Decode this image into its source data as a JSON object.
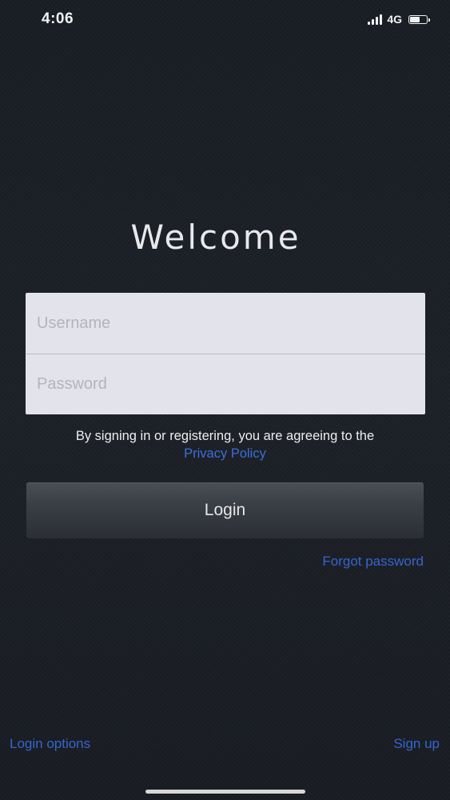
{
  "status_bar": {
    "time": "4:06",
    "network": "4G",
    "icons": [
      "signal-icon",
      "battery-icon"
    ]
  },
  "welcome": {
    "title": "Welcome"
  },
  "form": {
    "username_placeholder": "Username",
    "username_value": "",
    "password_placeholder": "Password",
    "password_value": ""
  },
  "terms": {
    "text": "By signing in or registering, you are agreeing to the",
    "privacy_link": "Privacy Policy"
  },
  "actions": {
    "login_label": "Login",
    "forgot_password": "Forgot password",
    "login_options": "Login options",
    "sign_up": "Sign up"
  },
  "colors": {
    "background": "#1b1f26",
    "link": "#3466cc",
    "field_background": "#e3e3ec",
    "button": "#3a3e45"
  }
}
